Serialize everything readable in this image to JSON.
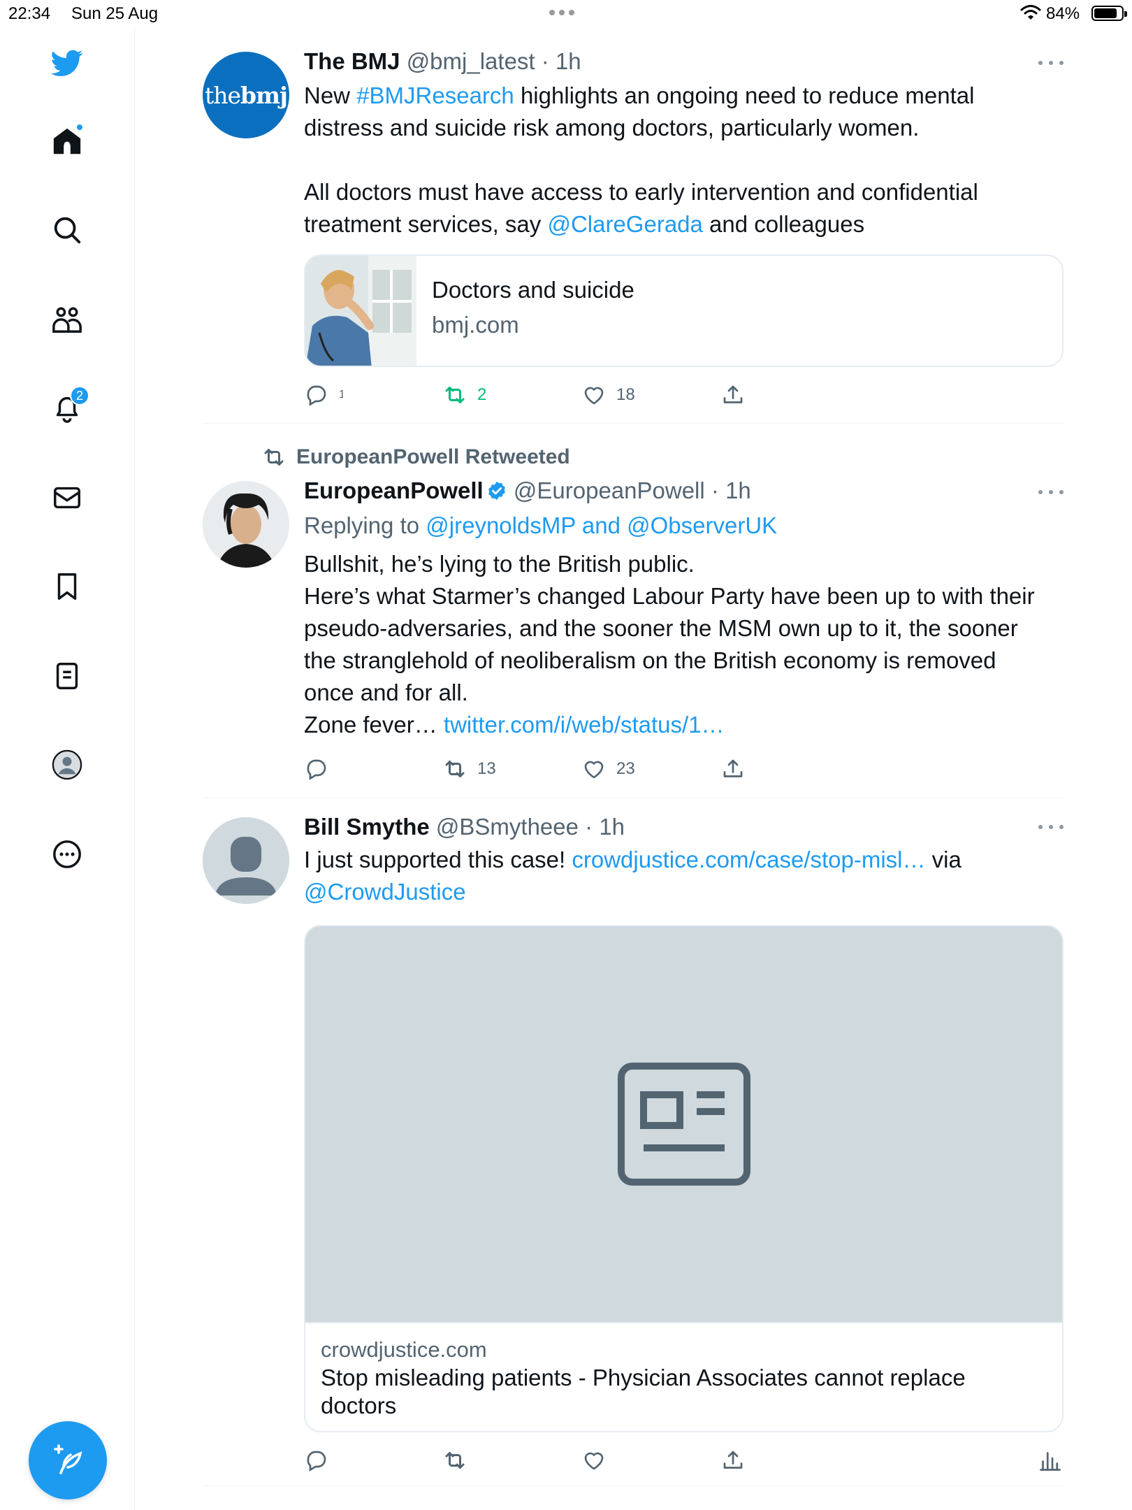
{
  "status_bar": {
    "time": "22:34",
    "date": "Sun 25 Aug",
    "battery": "84%",
    "battery_level": 0.84
  },
  "sidebar": {
    "notifications_badge": "2"
  },
  "tweets": [
    {
      "avatar_text": {
        "a": "the",
        "b": "bmj"
      },
      "name": "The BMJ",
      "handle": "@bmj_latest",
      "time": "· 1h",
      "text": {
        "l1_a": "New ",
        "l1_tag": "#BMJResearch",
        "l1_b": " highlights an ongoing need to reduce mental",
        "l2": "distress and suicide risk among doctors, particularly women.",
        "l3": "All doctors must have access to early intervention and confidential",
        "l4_a": "treatment services, say ",
        "l4_mention": "@ClareGerada",
        "l4_b": " and colleagues"
      },
      "card": {
        "title": "Doctors and suicide",
        "domain": "bmj.com"
      },
      "replies": "1",
      "retweets": "2",
      "likes": "18"
    },
    {
      "retweeted_by": "EuropeanPowell Retweeted",
      "name": "EuropeanPowell",
      "handle": "@EuropeanPowell",
      "time": "· 1h",
      "replying_prefix": "Replying to ",
      "replying_to": "@jreynoldsMP and @ObserverUK",
      "text": {
        "l1": "Bullshit, he’s lying to the British public.",
        "l2": "Here’s what Starmer’s changed Labour Party have been up to with their",
        "l3": "pseudo-adversaries, and the sooner the MSM own up to it, the sooner",
        "l4": "the stranglehold of neoliberalism on the British economy is removed",
        "l5": "once and for all.",
        "l6_a": "Zone fever… ",
        "l6_link": "twitter.com/i/web/status/1…"
      },
      "retweets": "13",
      "likes": "23"
    },
    {
      "name": "Bill Smythe",
      "handle": "@BSmytheee",
      "time": "· 1h",
      "text": {
        "l1_a": "I just supported this case! ",
        "l1_link": "crowdjustice.com/case/stop-misl…",
        "l1_b": " via",
        "l2_mention": "@CrowdJustice"
      },
      "card": {
        "domain": "crowdjustice.com",
        "title_l1": "Stop misleading patients - Physician Associates cannot replace",
        "title_l2": "doctors"
      }
    }
  ]
}
